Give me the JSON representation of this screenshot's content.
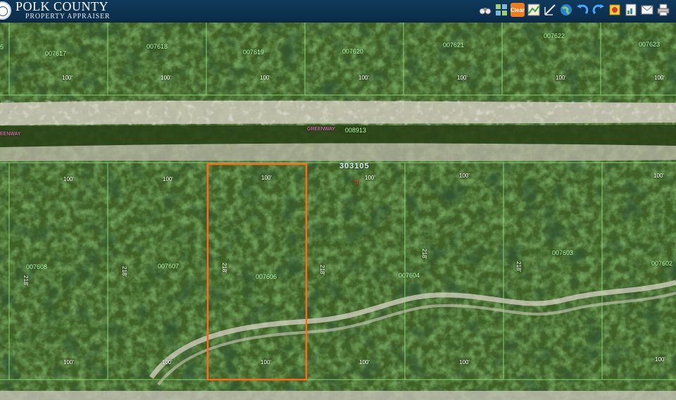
{
  "header": {
    "title": "POLK COUNTY",
    "subtitle": "PROPERTY APPRAISER"
  },
  "toolbar": [
    {
      "name": "binoculars-icon",
      "kind": "binoculars"
    },
    {
      "name": "layers-grid-icon",
      "kind": "grid"
    },
    {
      "name": "clear-button",
      "kind": "clear",
      "label": "Clear"
    },
    {
      "name": "map-export-icon",
      "kind": "mapdoc"
    },
    {
      "name": "measure-icon",
      "kind": "ruler"
    },
    {
      "name": "globe-icon",
      "kind": "globe"
    },
    {
      "name": "undo-icon",
      "kind": "undo"
    },
    {
      "name": "redo-icon",
      "kind": "redo"
    },
    {
      "name": "parcel-icon",
      "kind": "parcel"
    },
    {
      "name": "report-icon",
      "kind": "report"
    },
    {
      "name": "email-icon",
      "kind": "email"
    },
    {
      "name": "print-icon",
      "kind": "print"
    }
  ],
  "map": {
    "street": {
      "name_left": "EENWAY",
      "name": "GREENWAY",
      "parcel": "008913"
    },
    "section": "303105",
    "top_row": [
      {
        "parcel": "5",
        "dim": ""
      },
      {
        "parcel": "007617",
        "dim": "100'"
      },
      {
        "parcel": "007618",
        "dim": "100'"
      },
      {
        "parcel": "007619",
        "dim": "100'"
      },
      {
        "parcel": "007620",
        "dim": "100'"
      },
      {
        "parcel": "007621",
        "dim": "100'"
      },
      {
        "parcel": "007622",
        "dim": "100'"
      },
      {
        "parcel": "007623",
        "dim": "100'"
      }
    ],
    "bottom_row": [
      {
        "parcel": "007608",
        "dim_top": "100'",
        "dim_bottom": "100'",
        "side": "218'"
      },
      {
        "parcel": "007607",
        "dim_top": "100'",
        "dim_bottom": "100'",
        "side": "218'"
      },
      {
        "parcel": "007606",
        "dim_top": "100'",
        "dim_bottom": "100'",
        "side": "218'"
      },
      {
        "parcel": "007604",
        "dim_top": "100'",
        "dim_bottom": "100'",
        "side": "218'"
      },
      {
        "parcel": "007603",
        "dim_top": "100'",
        "dim_bottom": "100'",
        "side": "218'"
      },
      {
        "parcel": "007602",
        "dim_top": "100'",
        "dim_bottom": "100'",
        "side": "218'"
      }
    ],
    "lot_number": "70",
    "selected_parcel": "007606",
    "colors": {
      "header": "#0f3a5c",
      "parcel_line": "#8fe07a",
      "selection": "#ff6a1a",
      "parcel_text": "#b9ffb0",
      "street_text": "#ff6fe0",
      "vegetation": "#3d5c22",
      "sand": "#d9d6c8"
    }
  }
}
